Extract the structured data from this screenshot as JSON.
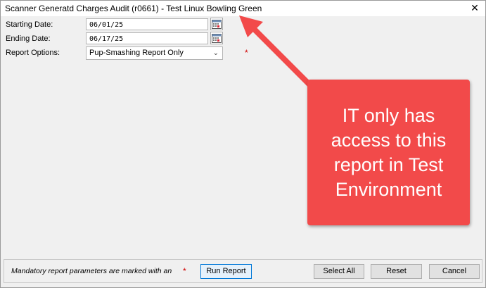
{
  "window": {
    "title": "Scanner Generatd Charges Audit (r0661) - Test Linux Bowling Green",
    "close_glyph": "✕"
  },
  "form": {
    "starting_date": {
      "label": "Starting Date:",
      "value": "06/01/25"
    },
    "ending_date": {
      "label": "Ending Date:",
      "value": "06/17/25"
    },
    "report_options": {
      "label": "Report Options:",
      "selected": "Pup-Smashing Report Only",
      "required_mark": "*"
    }
  },
  "footer": {
    "mandatory_text": "Mandatory report parameters are marked with an",
    "required_mark": "*",
    "run_report_label": "Run Report",
    "select_all_label": "Select All",
    "reset_label": "Reset",
    "cancel_label": "Cancel"
  },
  "annotation": {
    "callout_text": "IT only has access to this report in Test Environment",
    "color": "#f24a4a"
  },
  "icons": {
    "calendar": "calendar-icon",
    "dropdown": "chevron-down-icon",
    "close": "close-icon"
  }
}
